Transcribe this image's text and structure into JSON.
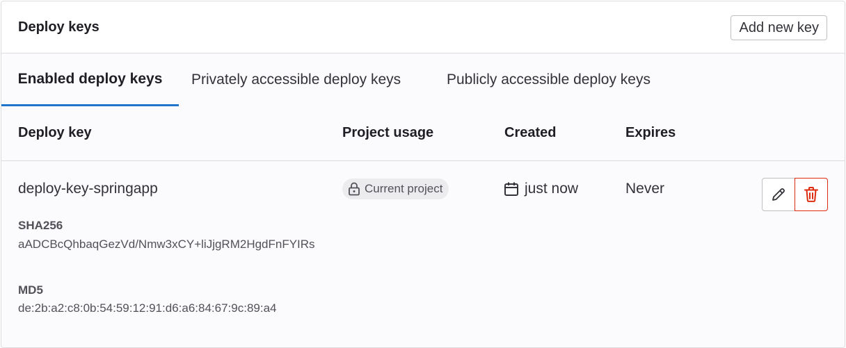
{
  "header": {
    "title": "Deploy keys",
    "add_button_label": "Add new key"
  },
  "tabs": [
    {
      "label": "Enabled deploy keys",
      "active": true
    },
    {
      "label": "Privately accessible deploy keys",
      "active": false
    },
    {
      "label": "Publicly accessible deploy keys",
      "active": false
    }
  ],
  "table": {
    "columns": [
      "Deploy key",
      "Project usage",
      "Created",
      "Expires"
    ],
    "rows": [
      {
        "title": "deploy-key-springapp",
        "sha256_label": "SHA256",
        "sha256_value": "aADCBcQhbaqGezVd/Nmw3xCY+liJjgRM2HgdFnFYIRs",
        "md5_label": "MD5",
        "md5_value": "de:2b:a2:c8:0b:54:59:12:91:d6:a6:84:67:9c:89:a4",
        "project_usage": "Current project",
        "created": "just now",
        "expires": "Never"
      }
    ]
  },
  "icons": {
    "usage": "lock-icon",
    "created": "calendar-icon",
    "edit": "pencil-icon",
    "delete": "trash-icon"
  },
  "colors": {
    "active_tab_underline": "#1f75cb",
    "danger": "#dd2b0e",
    "badge_bg": "#ececef"
  }
}
